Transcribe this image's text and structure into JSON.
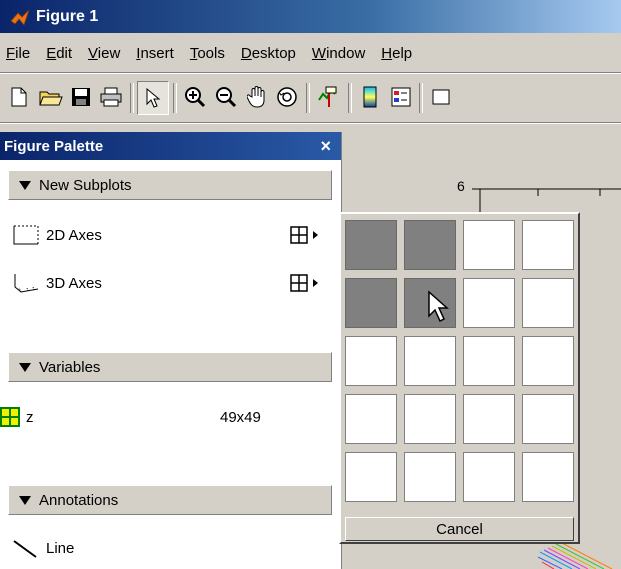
{
  "window": {
    "title": "Figure 1"
  },
  "menubar": {
    "items": [
      {
        "label": "File"
      },
      {
        "label": "Edit"
      },
      {
        "label": "View"
      },
      {
        "label": "Insert"
      },
      {
        "label": "Tools"
      },
      {
        "label": "Desktop"
      },
      {
        "label": "Window"
      },
      {
        "label": "Help"
      }
    ]
  },
  "toolbar": {
    "buttons": [
      {
        "icon": "new-file-icon"
      },
      {
        "icon": "open-folder-icon"
      },
      {
        "icon": "save-icon"
      },
      {
        "icon": "print-icon"
      },
      {
        "icon": "pointer-arrow-icon",
        "pressed": true
      },
      {
        "icon": "zoom-in-icon"
      },
      {
        "icon": "zoom-out-icon"
      },
      {
        "icon": "pan-hand-icon"
      },
      {
        "icon": "rotate-3d-icon"
      },
      {
        "icon": "data-cursor-icon"
      },
      {
        "icon": "colorbar-icon"
      },
      {
        "icon": "legend-icon"
      },
      {
        "icon": "hide-plot-tools-icon"
      }
    ]
  },
  "palette": {
    "title": "Figure Palette",
    "close_glyph": "×",
    "sections": {
      "new_subplots": {
        "label": "New Subplots",
        "items": [
          {
            "label": "2D Axes"
          },
          {
            "label": "3D Axes"
          }
        ]
      },
      "variables": {
        "label": "Variables",
        "items": [
          {
            "name": "z",
            "size": "49x49"
          }
        ]
      },
      "annotations": {
        "label": "Annotations",
        "items": [
          {
            "label": "Line"
          }
        ]
      }
    }
  },
  "figure": {
    "axis_tick_label": "6"
  },
  "subplot_popup": {
    "rows": 5,
    "cols": 4,
    "selected_rows": 2,
    "selected_cols": 2,
    "cancel_label": "Cancel"
  },
  "colors": {
    "title_bar": "#0a246a",
    "selection": "#808080"
  }
}
